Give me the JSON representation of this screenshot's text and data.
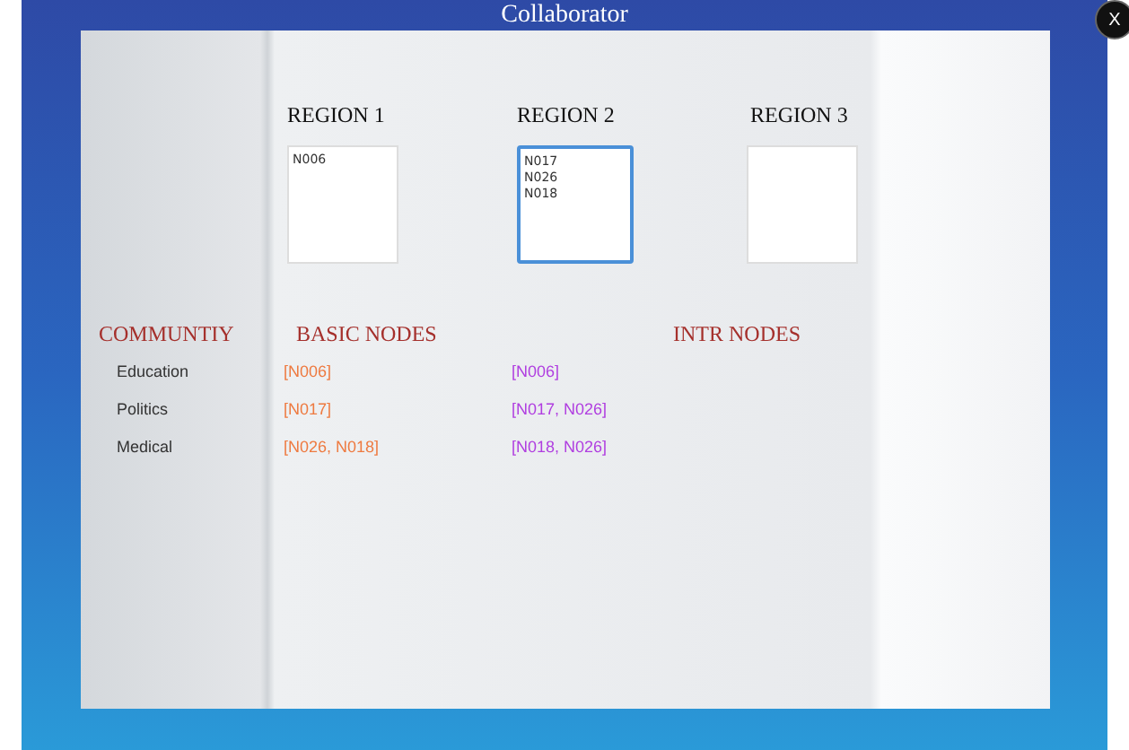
{
  "window": {
    "title": "Collaborator",
    "close": "X"
  },
  "regions": [
    {
      "label": "REGION 1",
      "items": [
        "N006"
      ],
      "selected": false
    },
    {
      "label": "REGION 2",
      "items": [
        "N017",
        "N026",
        "N018"
      ],
      "selected": true
    },
    {
      "label": "REGION 3",
      "selected": false
    }
  ],
  "table": {
    "columns": [
      "COMMUNTIY",
      "BASIC NODES",
      "INTR NODES"
    ],
    "rows": [
      {
        "community": "Education",
        "basic": "[N006]",
        "intr": "[N006]"
      },
      {
        "community": "Politics",
        "basic": "[N017]",
        "intr": "[N017, N026]"
      },
      {
        "community": "Medical",
        "basic": "[N026, N018]",
        "intr": "[N018, N026]"
      }
    ]
  }
}
